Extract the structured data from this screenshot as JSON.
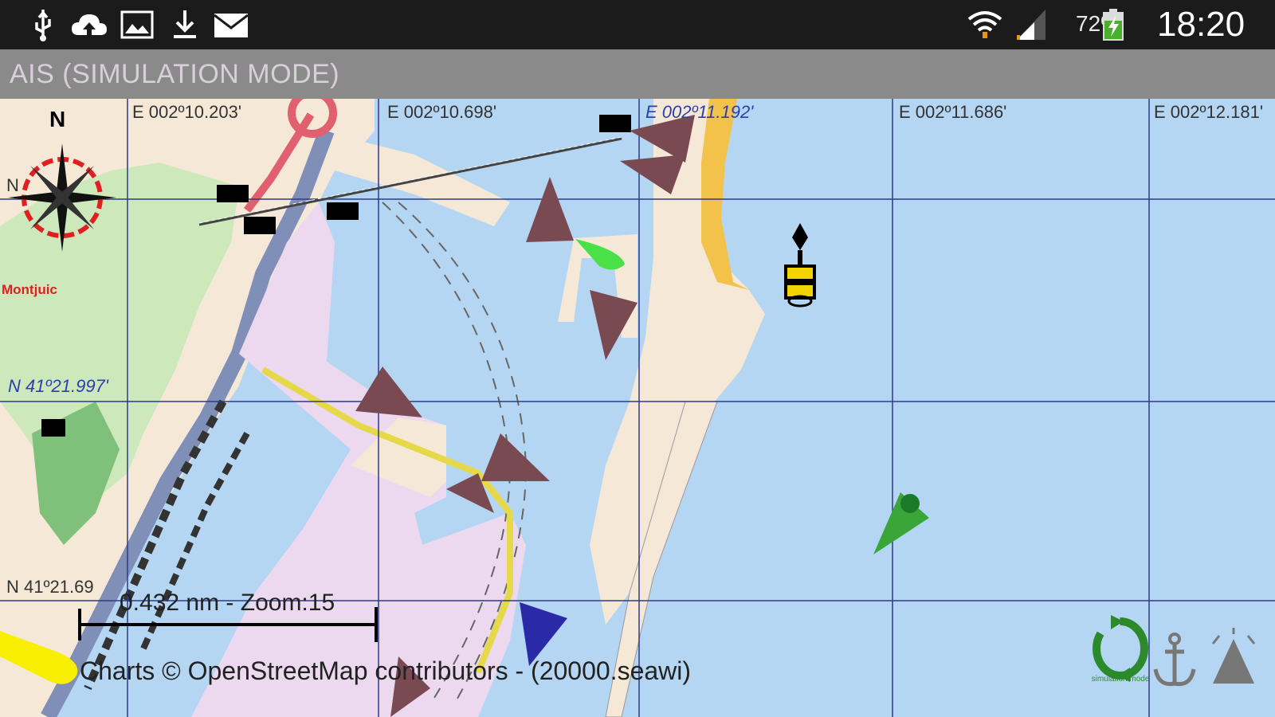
{
  "status_bar": {
    "left_icons": [
      "usb-icon",
      "cloud-upload-icon",
      "image-icon",
      "download-icon",
      "mail-icon"
    ],
    "right_icons": [
      "wifi-icon",
      "signal-icon",
      "battery-charging-icon"
    ],
    "battery_percent": "72%",
    "time": "18:20"
  },
  "app_bar": {
    "title": "AIS (SIMULATION MODE)"
  },
  "map": {
    "longitude_labels": [
      "E 002º10.203'",
      "E 002º10.698'",
      "E 002º11.192'",
      "E 002º11.686'",
      "E 002º12.181'"
    ],
    "latitude_labels": [
      "N",
      "N 41º21.997'",
      "N  41º21.69"
    ],
    "place_labels": [
      "Montjuic"
    ],
    "compass_north": "N",
    "scale": "0.432 nm - Zoom:15",
    "attribution": "Charts © OpenStreetMap contributors - (20000.seawi)",
    "colors": {
      "sea": "#b5d6f2",
      "land": "#f6e8d6",
      "port_area": "#ecd9ef",
      "park": "#cde9bc",
      "vessel": "#7a4a52",
      "own_ship": "#2a2aa8",
      "green_vessel": "#3aa63a",
      "buoy": "#f2d500"
    }
  },
  "controls": {
    "simulation_label": "simulation mode",
    "buttons": [
      "simulation-mode-icon",
      "anchor-icon",
      "ais-target-icon"
    ]
  }
}
